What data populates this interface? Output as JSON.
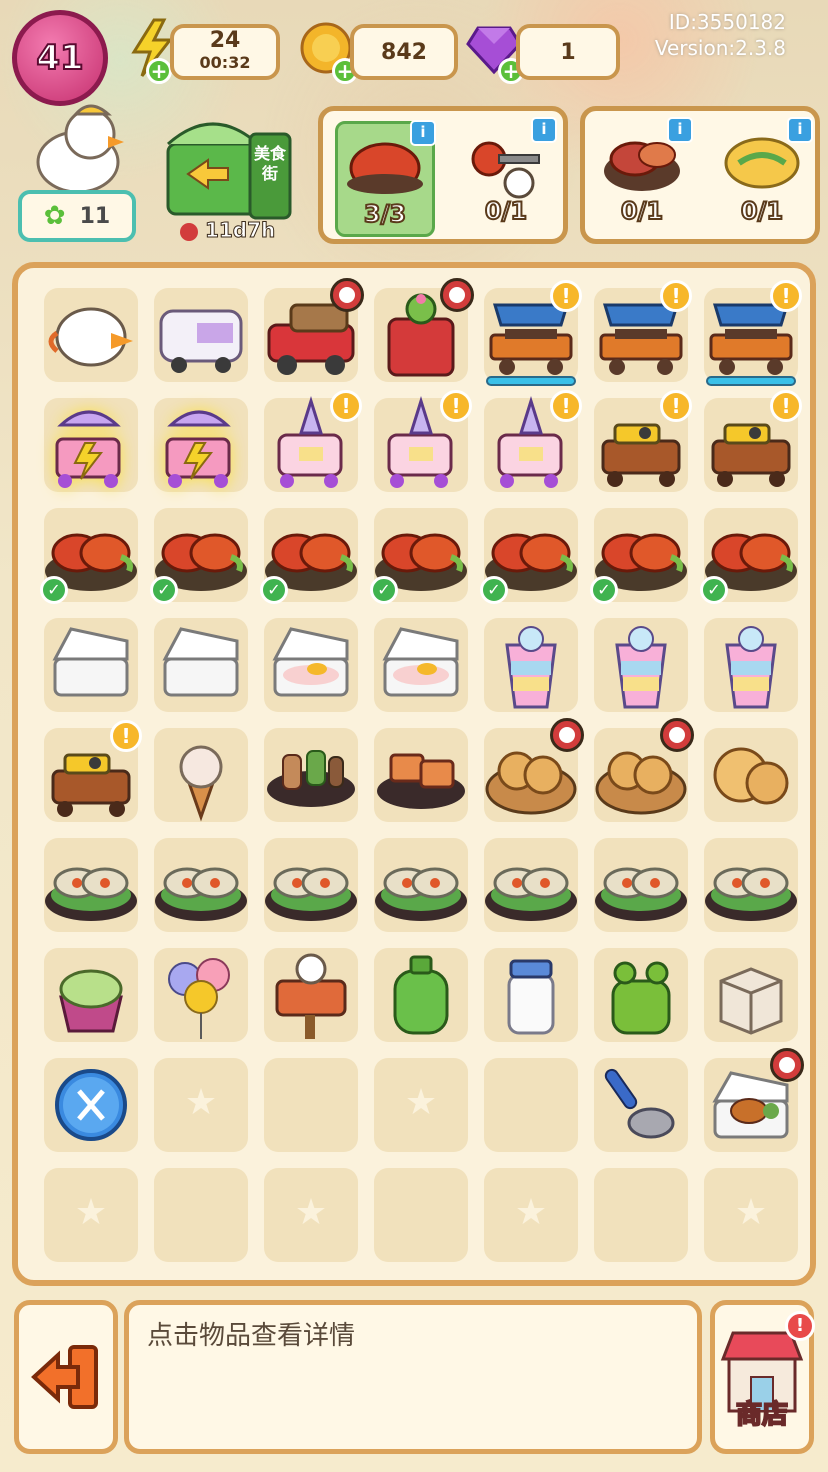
{
  "hud": {
    "level": "41",
    "energy": {
      "value": "24",
      "timer": "00:32"
    },
    "coins": "842",
    "gems": "1",
    "id_text": "ID:3550182",
    "version_text": "Version:2.3.8",
    "stars": "11",
    "event_timer": "11d7h",
    "event_label": "美食街"
  },
  "orders": [
    {
      "icon": "crayfish-icon",
      "progress": "3/3",
      "done": true
    },
    {
      "icon": "keys-icon",
      "progress": "0/1",
      "done": false
    },
    {
      "icon": "meat-platter-icon",
      "progress": "0/1",
      "done": false
    },
    {
      "icon": "omelette-icon",
      "progress": "0/1",
      "done": false
    }
  ],
  "board": {
    "rows": [
      [
        {
          "icon": "mask-icon"
        },
        {
          "icon": "food-van-icon"
        },
        {
          "icon": "truck-icon",
          "badge": "clock"
        },
        {
          "icon": "cactus-box-icon",
          "badge": "clock"
        },
        {
          "icon": "bbq-stall-icon",
          "badge": "excl",
          "bar": true
        },
        {
          "icon": "bbq-stall-icon",
          "badge": "excl"
        },
        {
          "icon": "bbq-stall-icon",
          "badge": "excl",
          "bar": true
        }
      ],
      [
        {
          "icon": "drink-cart-icon",
          "glow": true
        },
        {
          "icon": "drink-cart-icon",
          "glow": true
        },
        {
          "icon": "icecream-cart-icon",
          "badge": "excl"
        },
        {
          "icon": "icecream-cart-icon",
          "badge": "excl"
        },
        {
          "icon": "icecream-cart-icon",
          "badge": "excl"
        },
        {
          "icon": "cooker-cart-icon",
          "badge": "excl"
        },
        {
          "icon": "cooker-cart-icon",
          "badge": "excl"
        }
      ],
      [
        {
          "icon": "crayfish-plate-icon",
          "badge": "check"
        },
        {
          "icon": "crayfish-plate-icon",
          "badge": "check"
        },
        {
          "icon": "crayfish-plate-icon",
          "badge": "check"
        },
        {
          "icon": "crayfish-plate-icon",
          "badge": "check"
        },
        {
          "icon": "crayfish-plate-icon",
          "badge": "check"
        },
        {
          "icon": "crayfish-plate-icon",
          "badge": "check"
        },
        {
          "icon": "crayfish-plate-icon",
          "badge": "check"
        }
      ],
      [
        {
          "icon": "lunchbox-empty-icon"
        },
        {
          "icon": "lunchbox-empty-icon"
        },
        {
          "icon": "lunchbox-rice-icon"
        },
        {
          "icon": "lunchbox-rice-icon"
        },
        {
          "icon": "rainbow-drink-icon"
        },
        {
          "icon": "rainbow-drink-icon"
        },
        {
          "icon": "rainbow-drink-icon"
        }
      ],
      [
        {
          "icon": "cooker-cart-icon",
          "badge": "excl"
        },
        {
          "icon": "icecream-cone-icon"
        },
        {
          "icon": "skewers-icon"
        },
        {
          "icon": "grilled-squid-icon"
        },
        {
          "icon": "pancake-basket-icon",
          "badge": "clock"
        },
        {
          "icon": "pancake-basket-icon",
          "badge": "clock"
        },
        {
          "icon": "pancakes-icon"
        }
      ],
      [
        {
          "icon": "oyster-plate-icon"
        },
        {
          "icon": "oyster-plate-icon"
        },
        {
          "icon": "oyster-plate-icon"
        },
        {
          "icon": "oyster-plate-icon"
        },
        {
          "icon": "oyster-plate-icon"
        },
        {
          "icon": "oyster-plate-icon"
        },
        {
          "icon": "oyster-plate-icon"
        }
      ],
      [
        {
          "icon": "froyo-icon"
        },
        {
          "icon": "balloons-icon"
        },
        {
          "icon": "open-sign-icon"
        },
        {
          "icon": "gas-tank-icon"
        },
        {
          "icon": "milk-jar-icon"
        },
        {
          "icon": "frog-bag-icon"
        },
        {
          "icon": "cardboard-box-icon"
        }
      ],
      [
        {
          "icon": "scissors-icon"
        },
        {
          "icon": "empty-star"
        },
        {
          "icon": "empty"
        },
        {
          "icon": "empty-star"
        },
        {
          "icon": "empty"
        },
        {
          "icon": "ladle-icon"
        },
        {
          "icon": "chicken-box-icon",
          "badge": "clock"
        }
      ],
      [
        {
          "icon": "empty-star"
        },
        {
          "icon": "empty"
        },
        {
          "icon": "empty-star"
        },
        {
          "icon": "empty"
        },
        {
          "icon": "empty-star"
        },
        {
          "icon": "empty"
        },
        {
          "icon": "empty-star"
        }
      ]
    ]
  },
  "bottom": {
    "message": "点击物品查看详情",
    "shop_label": "商店",
    "shop_alert": "!"
  }
}
